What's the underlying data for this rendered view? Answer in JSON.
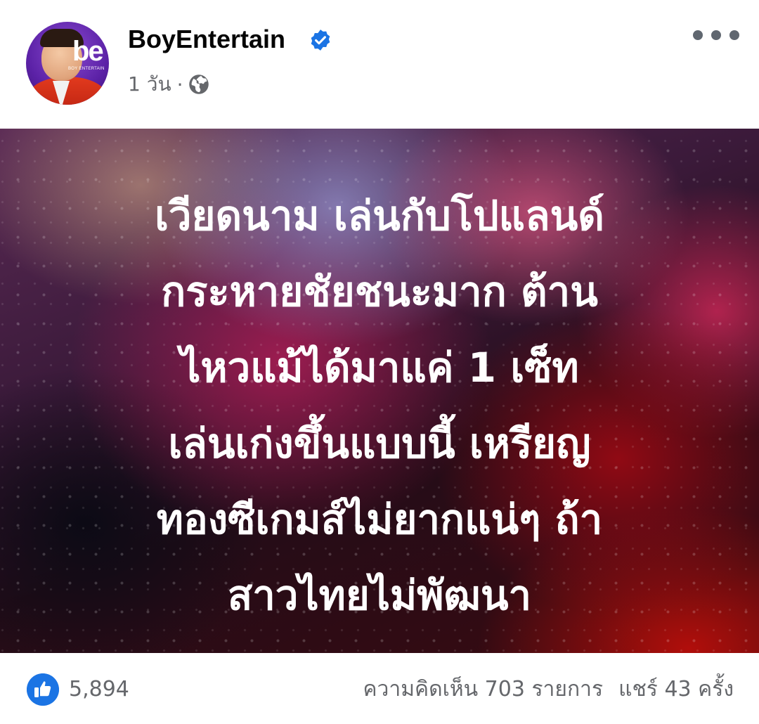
{
  "post": {
    "page_name": "BoyEntertain",
    "verified": true,
    "time": "1 วัน",
    "separator": "·",
    "audience_icon": "globe-icon",
    "more_icon": "more-options-icon",
    "avatar": {
      "logo_text": "be",
      "logo_subtext": "BOY ENTERTAIN"
    },
    "text": "เวียดนาม เล่นกับโปแลนด์\nกระหายชัยชนะมาก ต้าน\nไหวแม้ได้มาแค่ 1 เซ็ท\nเล่นเก่งขึ้นแบบนี้ เหรียญ\nทองซีเกมส์ไม่ยากแน่ๆ ถ้า\nสาวไทยไม่พัฒนา",
    "reactions": {
      "icon": "like-icon",
      "count": "5,894"
    },
    "comments_label": "ความคิดเห็น 703 รายการ",
    "shares_label": "แชร์ 43 ครั้ง"
  },
  "colors": {
    "verified_blue": "#1b74e4",
    "like_blue": "#1b74e4",
    "meta_gray": "#65676b",
    "name_black": "#050505"
  }
}
